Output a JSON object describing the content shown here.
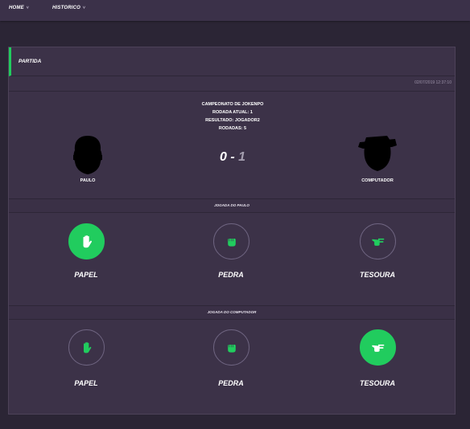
{
  "nav": {
    "home": "HOME",
    "history": "HISTORICO",
    "chevron": "˅"
  },
  "match": {
    "title": "PARTIDA",
    "timestamp": "02/07/2019 12:37:10",
    "info": {
      "line1": "CAMPEONATO DE JOKENPO",
      "line2": "RODADA ATUAL: 1",
      "line3": "RESULTADO: JOGADOR2",
      "line4": "RODADAS: 5"
    },
    "player": {
      "name": "PAULO"
    },
    "computer": {
      "name": "COMPUTADOR"
    },
    "score": {
      "player": "0",
      "separator": "-",
      "computer": "1"
    }
  },
  "sections": {
    "player_title": "JOGADA DO PAULO",
    "computer_title": "JOGADA DO COMPUTADOR"
  },
  "moves": {
    "paper": "PAPEL",
    "rock": "PEDRA",
    "scissors": "TESOURA"
  },
  "selection": {
    "player": "paper",
    "computer": "scissors"
  },
  "colors": {
    "accent": "#21cc5e",
    "card": "#3c3248",
    "background": "#2b2535"
  }
}
